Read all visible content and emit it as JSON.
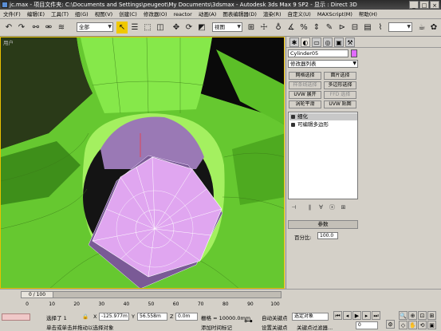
{
  "window": {
    "title": "jc.max - 项目文件夹: C:\\Documents and Settings\\peugeot\\My Documents\\3dsmax - Autodesk 3ds Max 9 SP2 - 显示 : Direct 3D",
    "min": "_",
    "max": "□",
    "close": "×"
  },
  "menu": [
    "文件(F)",
    "编辑(E)",
    "工具(T)",
    "组(G)",
    "视图(V)",
    "创建(C)",
    "修改器(O)",
    "reactor",
    "动画(A)",
    "图表编辑器(D)",
    "渲染(R)",
    "自定义(U)",
    "MAXScript(M)",
    "帮助(H)"
  ],
  "toolbar": {
    "selection_filter": "全部",
    "ref_coord": "视图",
    "named_selection": ""
  },
  "viewport": {
    "label": "用户"
  },
  "command_panel": {
    "tabs": [
      "✱",
      "◐",
      "▭",
      "◎",
      "▣",
      "⚒"
    ],
    "object_name": "Cylinder05",
    "object_color": "#e06bff",
    "modifier_list": "修改器列表",
    "buttons": [
      {
        "label": "网格选择",
        "disabled": false
      },
      {
        "label": "面片选择",
        "disabled": false
      },
      {
        "label": "样条线选择",
        "disabled": true
      },
      {
        "label": "多边形选择",
        "disabled": false
      },
      {
        "label": "UVW 展开",
        "disabled": false
      },
      {
        "label": "FFD 选择",
        "disabled": true
      },
      {
        "label": "涡轮平滑",
        "disabled": false
      },
      {
        "label": "UVW 贴图",
        "disabled": false
      }
    ],
    "stack": [
      {
        "label": "细化",
        "selected": true
      },
      {
        "label": "可编辑多边形",
        "selected": false
      }
    ],
    "rollout_title": "参数",
    "param_label": "百分比:",
    "param_value": "100.0"
  },
  "timeline": {
    "position": "0 / 100",
    "ticks": [
      "0",
      "10",
      "20",
      "30",
      "40",
      "50",
      "60",
      "70",
      "80",
      "90",
      "100"
    ]
  },
  "status": {
    "selected": "选择了 1",
    "x": "-125.977m",
    "y": "56.558m",
    "z": "0.0m",
    "grid": "栅格 = 10000.0mm",
    "prompt": "单击或单击并拖动以选择对象",
    "add_time_tag": "添加时间标记",
    "auto_key": "自动关键点",
    "selected_obj": "选定对象",
    "set_key": "设置关键点",
    "key_filters": "关键点过滤器...",
    "frame": "0"
  }
}
